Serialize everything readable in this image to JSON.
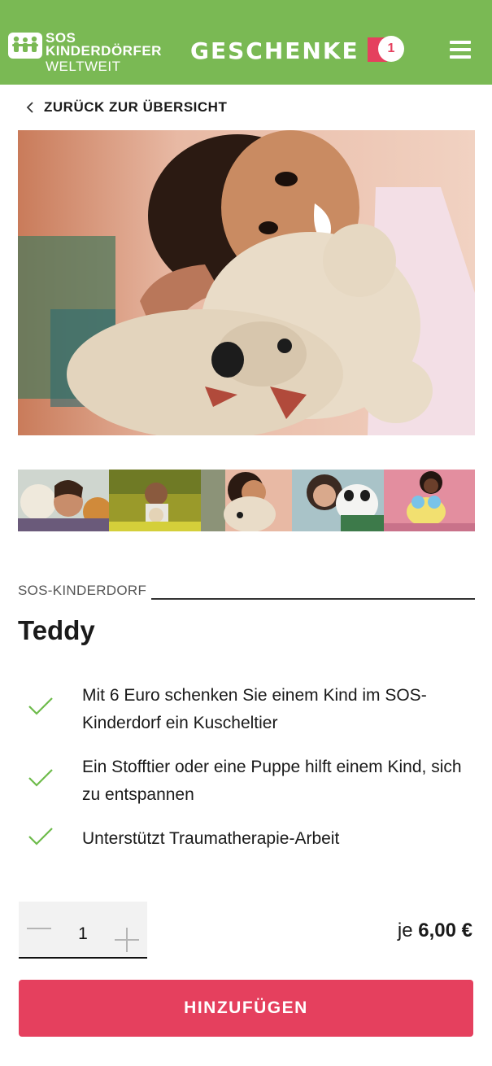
{
  "header": {
    "logo": {
      "line1": "SOS",
      "line2": "KINDERDÖRFER",
      "line3": "WELTWEIT"
    },
    "title": "GESCHENKE",
    "cart_count": "1",
    "menu_icon": "hamburger-menu-icon"
  },
  "back": {
    "label": "ZURÜCK ZUR ÜBERSICHT",
    "icon": "chevron-left-icon"
  },
  "gallery": {
    "main_image": "girl-hugging-teddy-bear",
    "thumbnails": [
      "teddy-bears-child",
      "child-with-teddy-outdoors",
      "girl-hugging-teddy-bear",
      "girl-with-panda-plush",
      "girl-with-plush-toy"
    ]
  },
  "product": {
    "category": "SOS-KINDERDORF",
    "title": "Teddy",
    "features": [
      "Mit 6 Euro schenken Sie einem Kind im SOS-Kinderdorf ein Kuscheltier",
      "Ein Stofftier oder eine Puppe hilft einem Kind, sich zu entspannen",
      "Unterstützt Traumatherapie-Arbeit"
    ]
  },
  "purchase": {
    "quantity": "1",
    "price_prefix": "je",
    "price": "6,00 €",
    "add_button": "HINZUFÜGEN"
  },
  "colors": {
    "brand_green": "#7ab954",
    "accent_pink": "#e5405e",
    "check_green": "#6dbb4a"
  }
}
